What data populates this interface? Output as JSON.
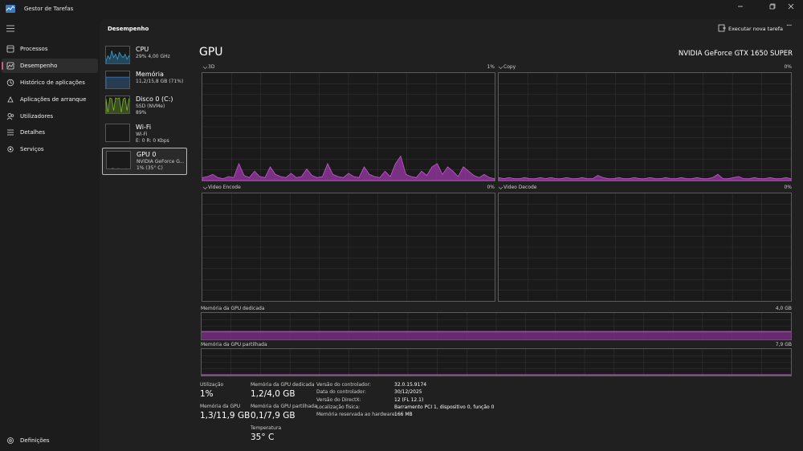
{
  "window": {
    "title": "Gestor de Tarefas",
    "controls": [
      "minimize-icon",
      "maximize-icon",
      "close-icon"
    ]
  },
  "sidebar": {
    "items": [
      {
        "label": "Processos",
        "icon": "processes-icon",
        "active": false
      },
      {
        "label": "Desempenho",
        "icon": "performance-icon",
        "active": true
      },
      {
        "label": "Histórico de aplicações",
        "icon": "app-history-icon",
        "active": false
      },
      {
        "label": "Aplicações de arranque",
        "icon": "startup-apps-icon",
        "active": false
      },
      {
        "label": "Utilizadores",
        "icon": "users-icon",
        "active": false
      },
      {
        "label": "Detalhes",
        "icon": "details-icon",
        "active": false
      },
      {
        "label": "Serviços",
        "icon": "services-icon",
        "active": false
      }
    ],
    "settings_label": "Definições"
  },
  "header": {
    "title": "Desempenho",
    "run_task_label": "Executar nova tarefa",
    "more_label": "···"
  },
  "devices": [
    {
      "name": "CPU",
      "line1": "29%  4,00 GHz",
      "line2": "",
      "color": "#3aa0d6",
      "selected": false,
      "trace": [
        0.2,
        0.5,
        0.3,
        0.8,
        0.4,
        0.6,
        0.3,
        0.7,
        0.5,
        0.4,
        0.6,
        0.3,
        0.5,
        0.2
      ]
    },
    {
      "name": "Memória",
      "line1": "11,2/15,8 GB (71%)",
      "line2": "",
      "color": "#3f7fc0",
      "selected": false,
      "trace": [
        0.71,
        0.71,
        0.71,
        0.71,
        0.71,
        0.71,
        0.71,
        0.71,
        0.71,
        0.71,
        0.71,
        0.71,
        0.71,
        0.71
      ]
    },
    {
      "name": "Disco 0 (C:)",
      "line1": "SSD (NVMe)",
      "line2": "89%",
      "color": "#7bb32e",
      "selected": false,
      "trace": [
        0.9,
        0.1,
        0.95,
        0.9,
        0.2,
        0.95,
        0.9,
        0.95,
        0.1,
        0.9,
        0.95,
        0.2,
        0.9,
        0.95
      ]
    },
    {
      "name": "Wi-Fi",
      "line1": "Wi-Fi",
      "line2": "E: 0  R: 0 Kbps",
      "color": "#c23a6e",
      "selected": false,
      "trace": [
        0.0,
        0.0,
        0.0,
        0.0,
        0.0,
        0.0,
        0.0,
        0.0,
        0.0,
        0.0,
        0.0,
        0.0,
        0.0,
        0.0
      ]
    },
    {
      "name": "GPU 0",
      "line1": "NVIDIA GeForce G...",
      "line2": "1% (35° C)",
      "color": "#a23fb0",
      "selected": true,
      "trace": [
        0.02,
        0.04,
        0.01,
        0.06,
        0.03,
        0.02,
        0.05,
        0.02,
        0.03,
        0.01,
        0.04,
        0.02,
        0.03,
        0.02
      ]
    }
  ],
  "gpu": {
    "title": "GPU",
    "model": "NVIDIA GeForce GTX 1650 SUPER",
    "graphs": [
      {
        "label": "3D",
        "pct": "1%",
        "trace": [
          0.02,
          0.03,
          0.05,
          0.02,
          0.01,
          0.03,
          0.02,
          0.15,
          0.04,
          0.02,
          0.08,
          0.03,
          0.02,
          0.12,
          0.05,
          0.03,
          0.02,
          0.06,
          0.02,
          0.03,
          0.1,
          0.04,
          0.02,
          0.03,
          0.15,
          0.05,
          0.03,
          0.02,
          0.06,
          0.03,
          0.02,
          0.12,
          0.05,
          0.03,
          0.02,
          0.08,
          0.03,
          0.15,
          0.22,
          0.05,
          0.03,
          0.02,
          0.08,
          0.04,
          0.12,
          0.15,
          0.05,
          0.12,
          0.08,
          0.03,
          0.12,
          0.08,
          0.04,
          0.02,
          0.05,
          0.02,
          0.01
        ]
      },
      {
        "label": "Copy",
        "pct": "0%",
        "trace": [
          0.02,
          0.01,
          0.02,
          0.01,
          0.01,
          0.02,
          0.01,
          0.01,
          0.02,
          0.01,
          0.02,
          0.01,
          0.01,
          0.02,
          0.01,
          0.01,
          0.02,
          0.01,
          0.01,
          0.04,
          0.02,
          0.01,
          0.01,
          0.02,
          0.01,
          0.01,
          0.02,
          0.01,
          0.01,
          0.02,
          0.01,
          0.01,
          0.02,
          0.01,
          0.01,
          0.02,
          0.01,
          0.01,
          0.02,
          0.01,
          0.01,
          0.02,
          0.05,
          0.01,
          0.01,
          0.02,
          0.03,
          0.01,
          0.01,
          0.02,
          0.01,
          0.01,
          0.02,
          0.01,
          0.01,
          0.02,
          0.01
        ]
      },
      {
        "label": "Video Encode",
        "pct": "0%",
        "trace": []
      },
      {
        "label": "Video Decode",
        "pct": "0%",
        "trace": []
      }
    ],
    "dedicated": {
      "label": "Memória da GPU dedicada",
      "max": "4,0 GB",
      "fraction": 0.3
    },
    "shared": {
      "label": "Memória da GPU partilhada",
      "max": "7,9 GB",
      "fraction": 0.013
    },
    "stats": {
      "util_label": "Utilização",
      "util_value": "1%",
      "gpu_mem_label": "Memória da GPU",
      "gpu_mem_value": "1,3/11,9 GB",
      "ded_label": "Memória da GPU dedicada",
      "ded_value": "1,2/4,0 GB",
      "shared_label": "Memória da GPU partilhada",
      "shared_value": "0,1/7,9 GB",
      "temp_label": "Temperatura",
      "temp_value": "35° C"
    },
    "info": [
      {
        "key": "Versão do controlador:",
        "value": "32.0.15.9174"
      },
      {
        "key": "Data do controlador:",
        "value": "30/12/2025"
      },
      {
        "key": "Versão do DirectX:",
        "value": "12 (FL 12.1)"
      },
      {
        "key": "Localização física:",
        "value": "Barramento PCI 1, dispositivo 0, função 0"
      },
      {
        "key": "Memória reservada ao hardware:",
        "value": "166 MB"
      }
    ]
  }
}
